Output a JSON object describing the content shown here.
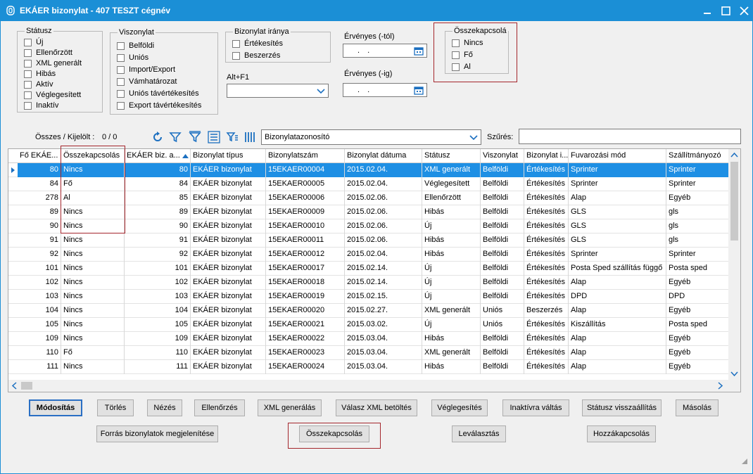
{
  "window": {
    "title": "EKÁER bizonylat   -   407 TESZT cégnév",
    "icon": "document-icon",
    "controls": [
      "minimize-icon",
      "maximize-icon",
      "close-icon"
    ]
  },
  "filters": {
    "status": {
      "legend": "Státusz",
      "items": [
        "Új",
        "Ellenőrzött",
        "XML generált",
        "Hibás",
        "Aktív",
        "Véglegesített",
        "Inaktív"
      ]
    },
    "relation": {
      "legend": "Viszonylat",
      "items": [
        "Belföldi",
        "Uniós",
        "Import/Export",
        "Vámhatározat",
        "Uniós távértékesítés",
        "Export távértékesítés"
      ]
    },
    "direction": {
      "legend": "Bizonylat iránya",
      "items": [
        "Értékesítés",
        "Beszerzés"
      ]
    },
    "altf1_label": "Alt+F1",
    "altf1_value": "",
    "valid_from_label": "Érvényes (-tól)",
    "valid_to_label": "Érvényes (-ig)",
    "date_placeholder": ". .",
    "link": {
      "legend": "Összekapcsolá",
      "items": [
        "Nincs",
        "Fő",
        "Al"
      ]
    }
  },
  "toolbar": {
    "count_label": "Összes / Kijelölt :",
    "count_value": "0 / 0",
    "icons": [
      "refresh-icon",
      "filter-icon",
      "filter-clear-icon",
      "list-icon",
      "filter-settings-icon",
      "columns-icon"
    ],
    "field_select": "Bizonylatazonosító",
    "filter_label": "Szűrés:",
    "filter_value": ""
  },
  "grid": {
    "columns": [
      "Fő EKÁE...",
      "Összekapcsolás",
      "EKÁER biz. a...",
      "Bizonylat típus",
      "Bizonylatszám",
      "Bizonylat dátuma",
      "Státusz",
      "Viszonylat",
      "Bizonylat i...",
      "Fuvarozási mód",
      "Szállítmányozó"
    ],
    "rows": [
      [
        "80",
        "Nincs",
        "80",
        "EKÁER bizonylat",
        "15EKAER00004",
        "2015.02.04.",
        "XML generált",
        "Belföldi",
        "Értékesítés",
        "Sprinter",
        "Sprinter"
      ],
      [
        "84",
        "Fő",
        "84",
        "EKÁER bizonylat",
        "15EKAER00005",
        "2015.02.04.",
        "Véglegesített",
        "Belföldi",
        "Értékesítés",
        "Sprinter",
        "Sprinter"
      ],
      [
        "278",
        "Al",
        "85",
        "EKÁER bizonylat",
        "15EKAER00006",
        "2015.02.06.",
        "Ellenőrzött",
        "Belföldi",
        "Értékesítés",
        "Alap",
        "Egyéb"
      ],
      [
        "89",
        "Nincs",
        "89",
        "EKÁER bizonylat",
        "15EKAER00009",
        "2015.02.06.",
        "Hibás",
        "Belföldi",
        "Értékesítés",
        "GLS",
        "gls"
      ],
      [
        "90",
        "Nincs",
        "90",
        "EKÁER bizonylat",
        "15EKAER00010",
        "2015.02.06.",
        "Új",
        "Belföldi",
        "Értékesítés",
        "GLS",
        "gls"
      ],
      [
        "91",
        "Nincs",
        "91",
        "EKÁER bizonylat",
        "15EKAER00011",
        "2015.02.06.",
        "Hibás",
        "Belföldi",
        "Értékesítés",
        "GLS",
        "gls"
      ],
      [
        "92",
        "Nincs",
        "92",
        "EKÁER bizonylat",
        "15EKAER00012",
        "2015.02.04.",
        "Hibás",
        "Belföldi",
        "Értékesítés",
        "Sprinter",
        "Sprinter"
      ],
      [
        "101",
        "Nincs",
        "101",
        "EKÁER bizonylat",
        "15EKAER00017",
        "2015.02.14.",
        "Új",
        "Belföldi",
        "Értékesítés",
        "Posta Sped szállítás függő",
        "Posta sped"
      ],
      [
        "102",
        "Nincs",
        "102",
        "EKÁER bizonylat",
        "15EKAER00018",
        "2015.02.14.",
        "Új",
        "Belföldi",
        "Értékesítés",
        "Alap",
        "Egyéb"
      ],
      [
        "103",
        "Nincs",
        "103",
        "EKÁER bizonylat",
        "15EKAER00019",
        "2015.02.15.",
        "Új",
        "Belföldi",
        "Értékesítés",
        "DPD",
        "DPD"
      ],
      [
        "104",
        "Nincs",
        "104",
        "EKÁER bizonylat",
        "15EKAER00020",
        "2015.02.27.",
        "XML generált",
        "Uniós",
        "Beszerzés",
        "Alap",
        "Egyéb"
      ],
      [
        "105",
        "Nincs",
        "105",
        "EKÁER bizonylat",
        "15EKAER00021",
        "2015.03.02.",
        "Új",
        "Uniós",
        "Értékesítés",
        "Kiszállítás",
        "Posta sped"
      ],
      [
        "109",
        "Nincs",
        "109",
        "EKÁER bizonylat",
        "15EKAER00022",
        "2015.03.04.",
        "Hibás",
        "Belföldi",
        "Értékesítés",
        "Alap",
        "Egyéb"
      ],
      [
        "110",
        "Fő",
        "110",
        "EKÁER bizonylat",
        "15EKAER00023",
        "2015.03.04.",
        "XML generált",
        "Belföldi",
        "Értékesítés",
        "Alap",
        "Egyéb"
      ],
      [
        "111",
        "Nincs",
        "111",
        "EKÁER bizonylat",
        "15EKAER00024",
        "2015.03.04.",
        "Hibás",
        "Belföldi",
        "Értékesítés",
        "Alap",
        "Egyéb"
      ]
    ]
  },
  "buttons": {
    "row1": [
      "Módosítás",
      "Törlés",
      "Nézés",
      "Ellenőrzés",
      "XML generálás",
      "Válasz XML betöltés",
      "Véglegesítés",
      "Inaktívra váltás",
      "Státusz visszaállítás",
      "Másolás"
    ],
    "row2": [
      "Forrás bizonylatok megjelenítése",
      "Összekapcsolás",
      "Leválasztás",
      "Hozzákapcsolás"
    ]
  },
  "colors": {
    "titlebar": "#1b8fd6",
    "selection": "#1e8fe4",
    "highlight": "#a4262c"
  }
}
